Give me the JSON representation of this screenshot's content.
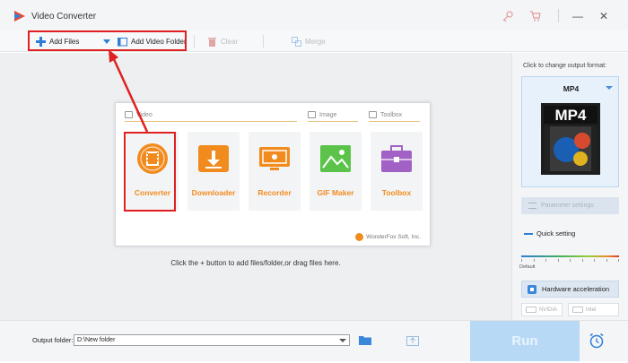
{
  "window": {
    "title": "Video Converter",
    "controls": {
      "minimize": "—",
      "close": "✕"
    }
  },
  "toolbar": {
    "add_files": "Add Files",
    "add_video_folder": "Add Video Folder",
    "clear": "Clear",
    "merge": "Merge"
  },
  "main": {
    "sections": {
      "video": "Video",
      "image": "Image",
      "toolbox": "Toolbox"
    },
    "tiles": [
      {
        "label": "Converter",
        "color": "#f28b1e"
      },
      {
        "label": "Downloader",
        "color": "#f28b1e"
      },
      {
        "label": "Recorder",
        "color": "#f28b1e"
      },
      {
        "label": "GIF Maker",
        "color": "#f28b1e"
      },
      {
        "label": "Toolbox",
        "color": "#f28b1e"
      }
    ],
    "brand": "WonderFox Soft, Inc.",
    "hint": "Click the + button to add files/folder,or drag files here."
  },
  "panel": {
    "hint": "Click to change output format:",
    "format": "MP4",
    "format_icon_text": "MP4",
    "parameter_settings": "Parameter settings",
    "quick_setting": "Quick setting",
    "default_label": "Default",
    "hardware_acceleration": "Hardware acceleration",
    "gpu_nvidia": "NVIDIA",
    "gpu_intel": "Intel"
  },
  "bottom": {
    "output_label": "Output folder:",
    "output_value": "D:\\New folder",
    "run": "Run"
  },
  "colors": {
    "accent": "#2e7dd7",
    "tile_text": "#f28b1e",
    "annotation": "#e02020",
    "run_disabled": "#b7d9f5"
  }
}
